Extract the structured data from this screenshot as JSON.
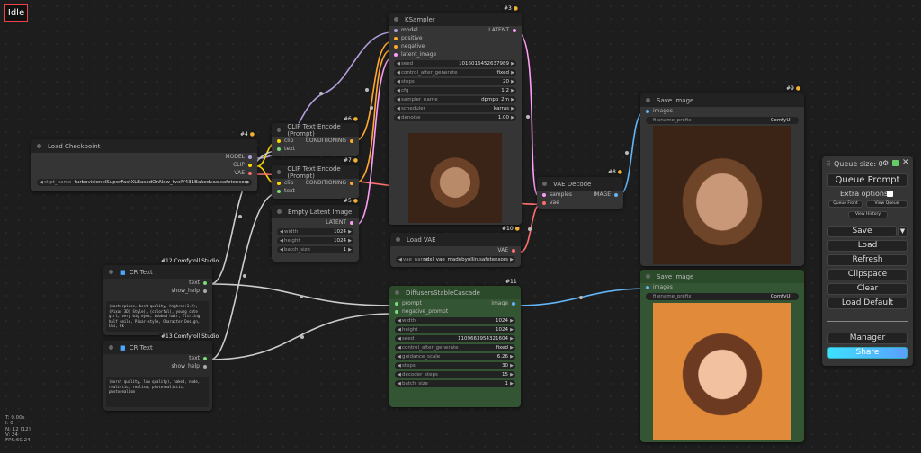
{
  "status": "Idle",
  "stats": [
    "T: 0.00s",
    "I: 0",
    "N: 12 [12]",
    "V: 24",
    "FPS:60.24"
  ],
  "colors": {
    "model": "#b39ddb",
    "clip": "#ffd500",
    "vae": "#ff6e6e",
    "conditioning": "#ffa931",
    "latent": "#ff9cf9",
    "image": "#64b5f6",
    "string": "#77dd77"
  },
  "nodes": {
    "load_checkpoint": {
      "title": "Load Checkpoint",
      "id": "#4",
      "outputs": [
        "MODEL",
        "CLIP",
        "VAE"
      ],
      "ckpt_label": "ckpt_name",
      "ckpt_value": "turbovisionxlSuperFastXLBasedOnNew_tvxlV431Bakedvae.safetensors"
    },
    "clip6": {
      "title": "CLIP Text Encode (Prompt)",
      "id": "#6",
      "inputs": [
        "clip",
        "text"
      ],
      "output": "CONDITIONING"
    },
    "clip7": {
      "title": "CLIP Text Encode (Prompt)",
      "id": "#7",
      "inputs": [
        "clip",
        "text"
      ],
      "output": "CONDITIONING"
    },
    "empty_latent": {
      "title": "Empty Latent Image",
      "id": "#5",
      "output": "LATENT",
      "widgets": [
        {
          "label": "width",
          "value": "1024"
        },
        {
          "label": "height",
          "value": "1024"
        },
        {
          "label": "batch_size",
          "value": "1"
        }
      ]
    },
    "ksampler": {
      "title": "KSampler",
      "id": "#3",
      "inputs": [
        "model",
        "positive",
        "negative",
        "latent_image"
      ],
      "output": "LATENT",
      "widgets": [
        {
          "label": "seed",
          "value": "1016016452637989"
        },
        {
          "label": "control_after_generate",
          "value": "fixed"
        },
        {
          "label": "steps",
          "value": "20"
        },
        {
          "label": "cfg",
          "value": "1.2"
        },
        {
          "label": "sampler_name",
          "value": "dpmpp_2m"
        },
        {
          "label": "scheduler",
          "value": "karras"
        },
        {
          "label": "denoise",
          "value": "1.00"
        }
      ]
    },
    "load_vae": {
      "title": "Load VAE",
      "id": "#10",
      "output": "VAE",
      "widget": {
        "label": "vae_name",
        "value": "sdxl_vae_madebyollin.safetensors"
      }
    },
    "vae_decode": {
      "title": "VAE Decode",
      "id": "#8",
      "inputs": [
        "samples",
        "vae"
      ],
      "output": "IMAGE"
    },
    "save9": {
      "title": "Save Image",
      "id": "#9",
      "input": "images",
      "widget": {
        "label": "filename_prefix",
        "value": "ComfyUI"
      }
    },
    "save11b": {
      "title": "Save Image",
      "input": "images",
      "widget": {
        "label": "filename_prefix",
        "value": "ComfyUI"
      }
    },
    "cascade": {
      "title": "DiffusersStableCascade",
      "id": "#11",
      "inputs": [
        "prompt",
        "negative_prompt"
      ],
      "output": "image",
      "widgets": [
        {
          "label": "width",
          "value": "1024"
        },
        {
          "label": "height",
          "value": "1024"
        },
        {
          "label": "seed",
          "value": "1109663954321604"
        },
        {
          "label": "control_after_generate",
          "value": "fixed"
        },
        {
          "label": "guidance_scale",
          "value": "6.26"
        },
        {
          "label": "steps",
          "value": "30"
        },
        {
          "label": "decoder_steps",
          "value": "15"
        },
        {
          "label": "batch_size",
          "value": "1"
        }
      ]
    },
    "cr12": {
      "title": "CR Text",
      "badge": "#12 Comfyroll Studio",
      "outputs": [
        "text",
        "show_help"
      ],
      "text": "(masterpiece, best quality, highres:1.2), (Pixar 3D) Style), (colorful), young cute girl, very big eyes, bobbed hair, flirting, half smile, Pixar-style, Character Design, CGI, 8k"
    },
    "cr13": {
      "title": "CR Text",
      "badge": "#13 Comfyroll Studio",
      "outputs": [
        "text",
        "show_help"
      ],
      "text": "(worst quality, low quality), naked, nude, realistic, realism, photorealistic, photorealism"
    }
  },
  "menu": {
    "queue_size": "Queue size: 0",
    "queue_prompt": "Queue Prompt",
    "extra_options": "Extra options",
    "queue_front": "Queue Front",
    "view_queue": "View Queue",
    "view_history": "View History",
    "save": "Save",
    "load": "Load",
    "refresh": "Refresh",
    "clipspace": "Clipspace",
    "clear": "Clear",
    "load_default": "Load Default",
    "manager": "Manager",
    "share": "Share",
    "share_gradient": [
      "#3ee0ff",
      "#5aa0ff"
    ]
  }
}
